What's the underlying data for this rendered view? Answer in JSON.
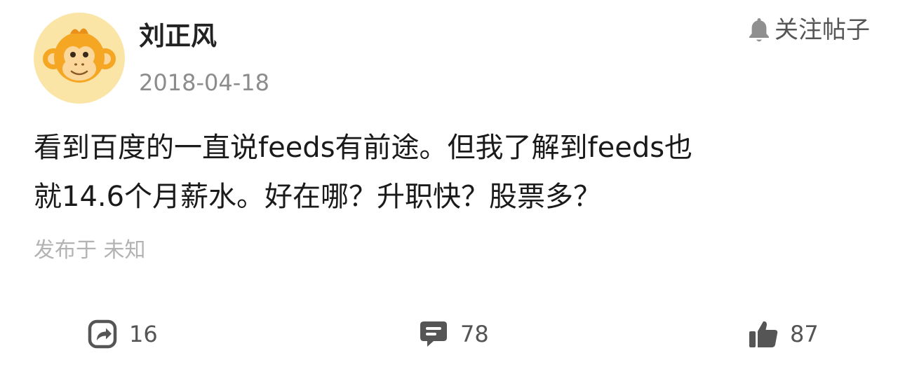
{
  "author": {
    "name": "刘正风",
    "avatar_icon": "monkey-avatar-icon"
  },
  "post": {
    "date": "2018-04-18",
    "follow_label": "关注帖子",
    "follow_icon": "bell-icon",
    "content_lines": [
      "看到百度的一直说feeds有前途。但我了解到feeds也",
      "就14.6个月薪水。好在哪？升职快？股票多？"
    ],
    "location": "发布于 未知"
  },
  "actions": {
    "share": {
      "icon": "share-icon",
      "count": "16"
    },
    "comment": {
      "icon": "comment-icon",
      "count": "78"
    },
    "like": {
      "icon": "thumbs-up-icon",
      "count": "87"
    }
  },
  "colors": {
    "avatar_bg": "#fbe5a6",
    "monkey_orange": "#f5a623",
    "icon_gray": "#555555",
    "muted_text": "#8c8c8c",
    "location_text": "#b3b3b3"
  }
}
